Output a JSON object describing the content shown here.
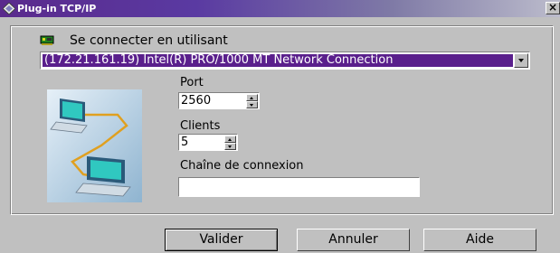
{
  "window": {
    "title": "Plug-in TCP/IP",
    "close_glyph": "×",
    "title_icon": "diamond-app-icon",
    "title_bar_color": "#5a2a8c"
  },
  "connection": {
    "label": "Se connecter en utilisant",
    "icon": "network-card-icon",
    "selected": "(172.21.161.19) Intel(R) PRO/1000 MT Network Connection",
    "selection_color": "#5a1f8c"
  },
  "port": {
    "label": "Port",
    "value": "2560"
  },
  "clients": {
    "label": "Clients",
    "value": "5"
  },
  "connection_string": {
    "label": "Chaîne de connexion",
    "value": ""
  },
  "buttons": {
    "ok": "Valider",
    "cancel": "Annuler",
    "help": "Aide"
  },
  "illustration": "two-computers-network-icon"
}
